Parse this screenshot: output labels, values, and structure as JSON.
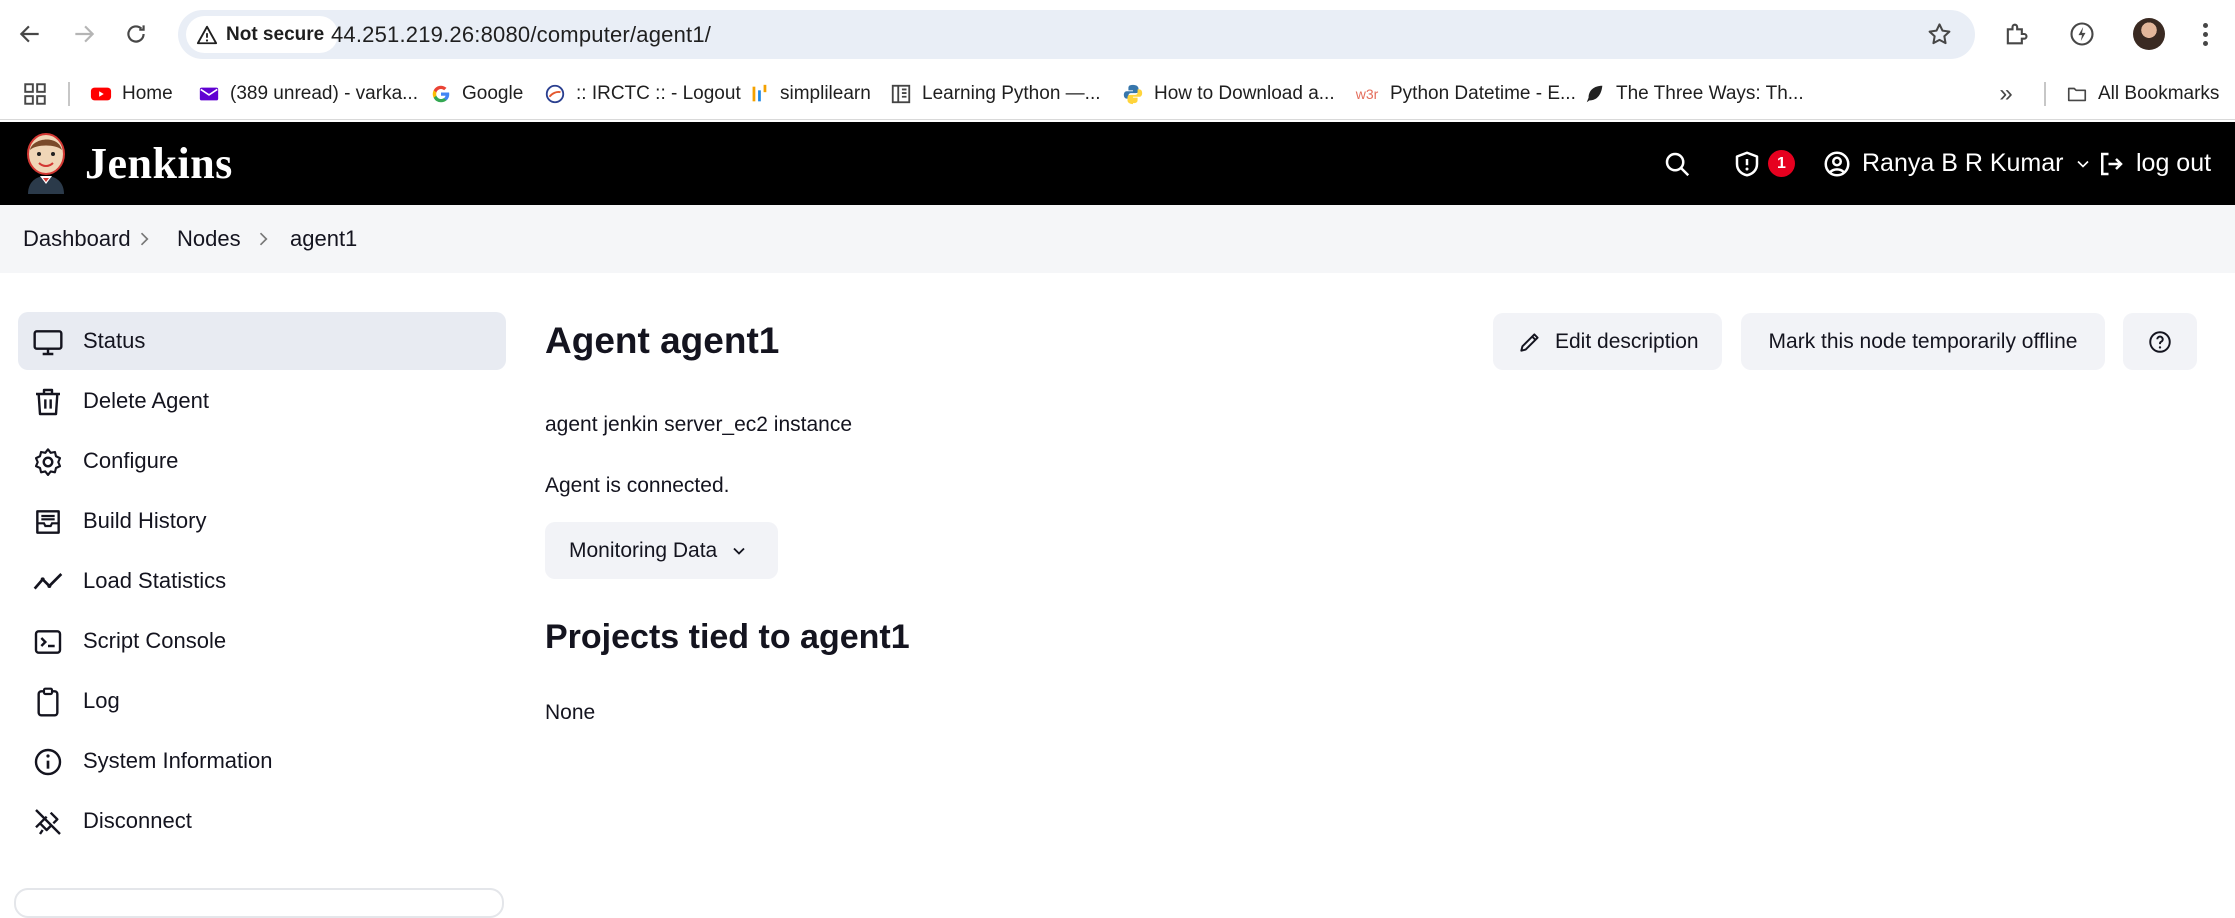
{
  "browser": {
    "security_label": "Not secure",
    "url": "44.251.219.26:8080/computer/agent1/",
    "bookmarks": [
      {
        "label": "Home",
        "icon": "youtube-icon"
      },
      {
        "label": "(389 unread) - varka...",
        "icon": "mail-icon"
      },
      {
        "label": "Google",
        "icon": "google-icon"
      },
      {
        "label": ":: IRCTC :: - Logout",
        "icon": "irctc-icon"
      },
      {
        "label": "simplilearn",
        "icon": "simplilearn-icon"
      },
      {
        "label": "Learning Python —...",
        "icon": "book-icon"
      },
      {
        "label": "How to Download a...",
        "icon": "python-icon"
      },
      {
        "label": "Python Datetime - E...",
        "icon": "w3schools-icon"
      },
      {
        "label": "The Three Ways: Th...",
        "icon": "leaf-icon"
      }
    ],
    "all_bookmarks_label": "All Bookmarks"
  },
  "header": {
    "title": "Jenkins",
    "security_count": "1",
    "user_name": "Ranya B R Kumar",
    "logout_label": "log out"
  },
  "breadcrumb": [
    "Dashboard",
    "Nodes",
    "agent1"
  ],
  "sidebar": {
    "items": [
      {
        "label": "Status",
        "icon": "monitor-icon",
        "active": true
      },
      {
        "label": "Delete Agent",
        "icon": "trash-icon"
      },
      {
        "label": "Configure",
        "icon": "gear-icon"
      },
      {
        "label": "Build History",
        "icon": "inbox-icon"
      },
      {
        "label": "Load Statistics",
        "icon": "trend-icon"
      },
      {
        "label": "Script Console",
        "icon": "terminal-icon"
      },
      {
        "label": "Log",
        "icon": "clipboard-icon"
      },
      {
        "label": "System Information",
        "icon": "info-icon"
      },
      {
        "label": "Disconnect",
        "icon": "unplug-icon"
      }
    ]
  },
  "main": {
    "title": "Agent agent1",
    "edit_description_label": "Edit description",
    "mark_offline_label": "Mark this node temporarily offline",
    "description": "agent jenkin server_ec2 instance",
    "status_text": "Agent is connected.",
    "monitoring_label": "Monitoring Data",
    "projects_title": "Projects tied to agent1",
    "projects_value": "None"
  },
  "colors": {
    "header_bg": "#000000",
    "badge": "#e6001f",
    "sidebar_active": "#e8ebf2",
    "button_bg": "#f2f3f7",
    "breadcrumb_bg": "#f5f6f8"
  }
}
